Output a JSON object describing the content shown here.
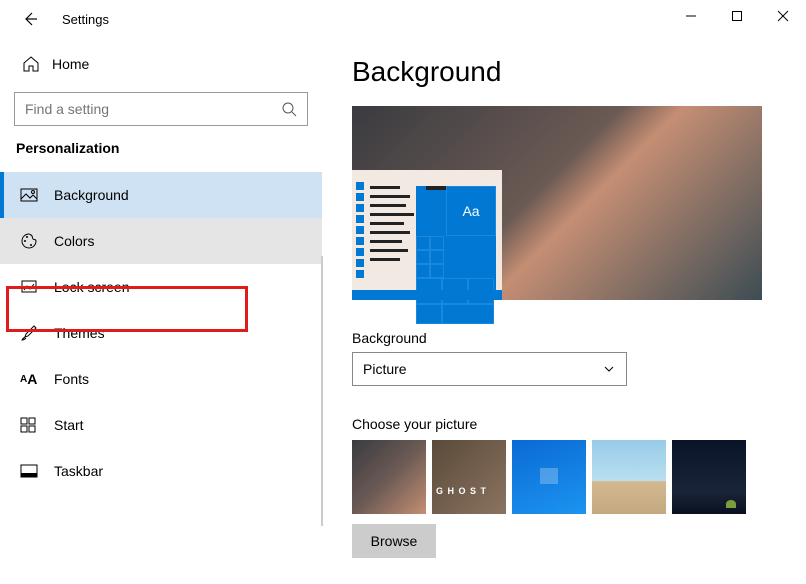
{
  "window": {
    "title": "Settings"
  },
  "sidebar": {
    "home": "Home",
    "search_placeholder": "Find a setting",
    "group": "Personalization",
    "items": [
      {
        "label": "Background"
      },
      {
        "label": "Colors"
      },
      {
        "label": "Lock screen"
      },
      {
        "label": "Themes"
      },
      {
        "label": "Fonts"
      },
      {
        "label": "Start"
      },
      {
        "label": "Taskbar"
      }
    ]
  },
  "main": {
    "title": "Background",
    "background_label": "Background",
    "background_value": "Picture",
    "choose_label": "Choose your picture",
    "browse_label": "Browse",
    "preview_sample": "Aa"
  }
}
